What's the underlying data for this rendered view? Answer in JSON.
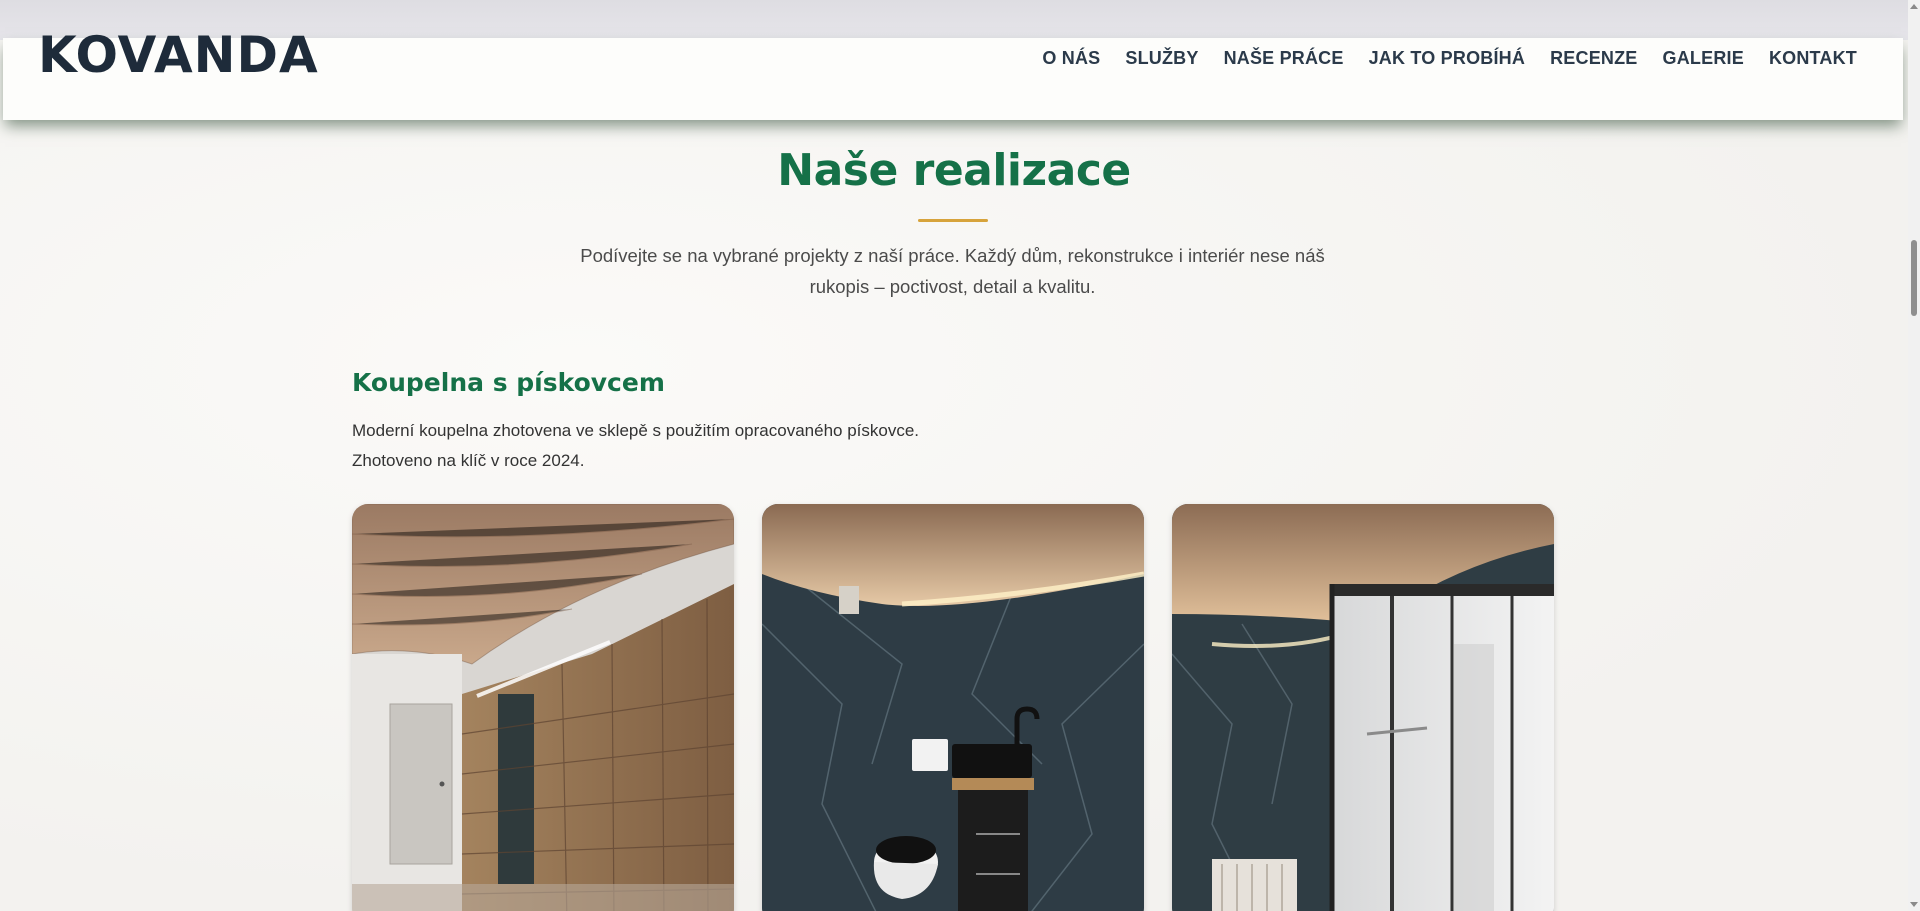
{
  "header": {
    "logo": "KOVANDA",
    "nav": [
      {
        "label": "O NÁS"
      },
      {
        "label": "SLUŽBY"
      },
      {
        "label": "NAŠE PRÁCE"
      },
      {
        "label": "JAK TO PROBÍHÁ"
      },
      {
        "label": "RECENZE"
      },
      {
        "label": "GALERIE"
      },
      {
        "label": "KONTAKT"
      }
    ]
  },
  "main": {
    "title": "Naše realizace",
    "intro": "Podívejte se na vybrané projekty z naší práce. Každý dům, rekonstrukce i interiér nese náš rukopis – poctivost, detail a kvalitu.",
    "project": {
      "title": "Koupelna s pískovcem",
      "description_line1": "Moderní koupelna zhotovena ve sklepě s použitím opracovaného pískovce.",
      "description_line2": "Zhotoveno na klíč v roce 2024."
    }
  },
  "colors": {
    "accent_green": "#157148",
    "underline_gold": "#d7a33b",
    "logo_navy": "#1e2b3a",
    "background": "#f6f5f2"
  }
}
